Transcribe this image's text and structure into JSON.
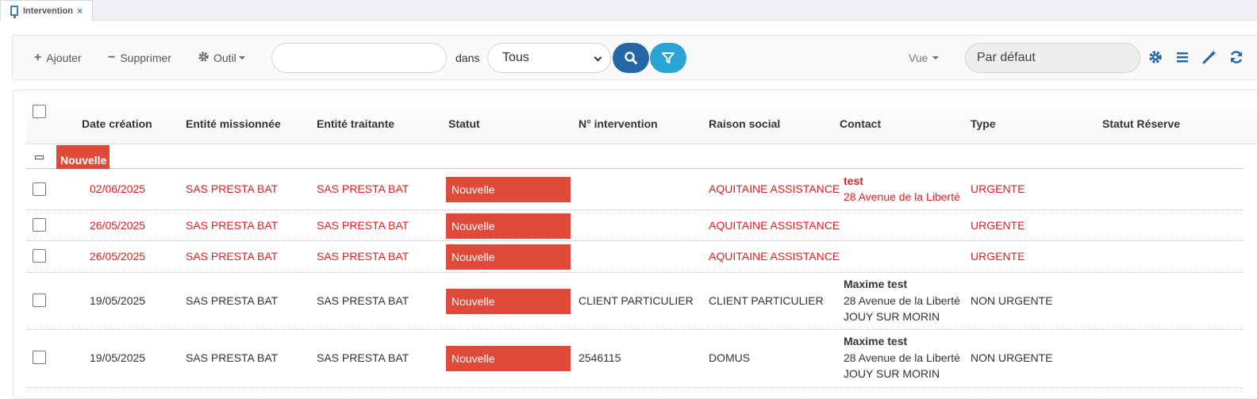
{
  "tab": {
    "title": "Intervention",
    "close": "×"
  },
  "toolbar": {
    "add_label": "Ajouter",
    "delete_label": "Supprimer",
    "tool_label": "Outil",
    "search_value": "",
    "in_label": "dans",
    "scope_value": "Tous",
    "view_label": "Vue",
    "view_value": "Par défaut"
  },
  "colors": {
    "primary": "#2466a6",
    "filter": "#2aa4d4",
    "status_new": "#e04a3a",
    "urgent_text": "#e02020"
  },
  "columns": [
    "Date création",
    "Entité missionnée",
    "Entité traitante",
    "Statut",
    "N° intervention",
    "Raison social",
    "Contact",
    "Type",
    "Statut Réserve"
  ],
  "group": {
    "label": "Nouvelle"
  },
  "rows": [
    {
      "date": "02/06/2025",
      "missionnee": "SAS PRESTA BAT",
      "traitante": "SAS PRESTA BAT",
      "statut": "Nouvelle",
      "numero": "",
      "raison": "AQUITAINE ASSISTANCE",
      "contact_name": "test",
      "contact_address": "28 Avenue de la Liberté",
      "contact_city": "",
      "type": "URGENTE"
    },
    {
      "date": "26/05/2025",
      "missionnee": "SAS PRESTA BAT",
      "traitante": "SAS PRESTA BAT",
      "statut": "Nouvelle",
      "numero": "",
      "raison": "AQUITAINE ASSISTANCE",
      "contact_name": "",
      "contact_address": "",
      "contact_city": "",
      "type": "URGENTE"
    },
    {
      "date": "26/05/2025",
      "missionnee": "SAS PRESTA BAT",
      "traitante": "SAS PRESTA BAT",
      "statut": "Nouvelle",
      "numero": "",
      "raison": "AQUITAINE ASSISTANCE",
      "contact_name": "",
      "contact_address": "",
      "contact_city": "",
      "type": "URGENTE"
    },
    {
      "date": "19/05/2025",
      "missionnee": "SAS PRESTA BAT",
      "traitante": "SAS PRESTA BAT",
      "statut": "Nouvelle",
      "numero": "CLIENT PARTICULIER",
      "raison": "CLIENT PARTICULIER",
      "contact_name": "Maxime test",
      "contact_address": "28 Avenue de la Liberté",
      "contact_city": "JOUY SUR MORIN",
      "type": "NON URGENTE"
    },
    {
      "date": "19/05/2025",
      "missionnee": "SAS PRESTA BAT",
      "traitante": "SAS PRESTA BAT",
      "statut": "Nouvelle",
      "numero": "2546115",
      "raison": "DOMUS",
      "contact_name": "Maxime test",
      "contact_address": "28 Avenue de la Liberté",
      "contact_city": "JOUY SUR MORIN",
      "type": "NON URGENTE"
    }
  ]
}
